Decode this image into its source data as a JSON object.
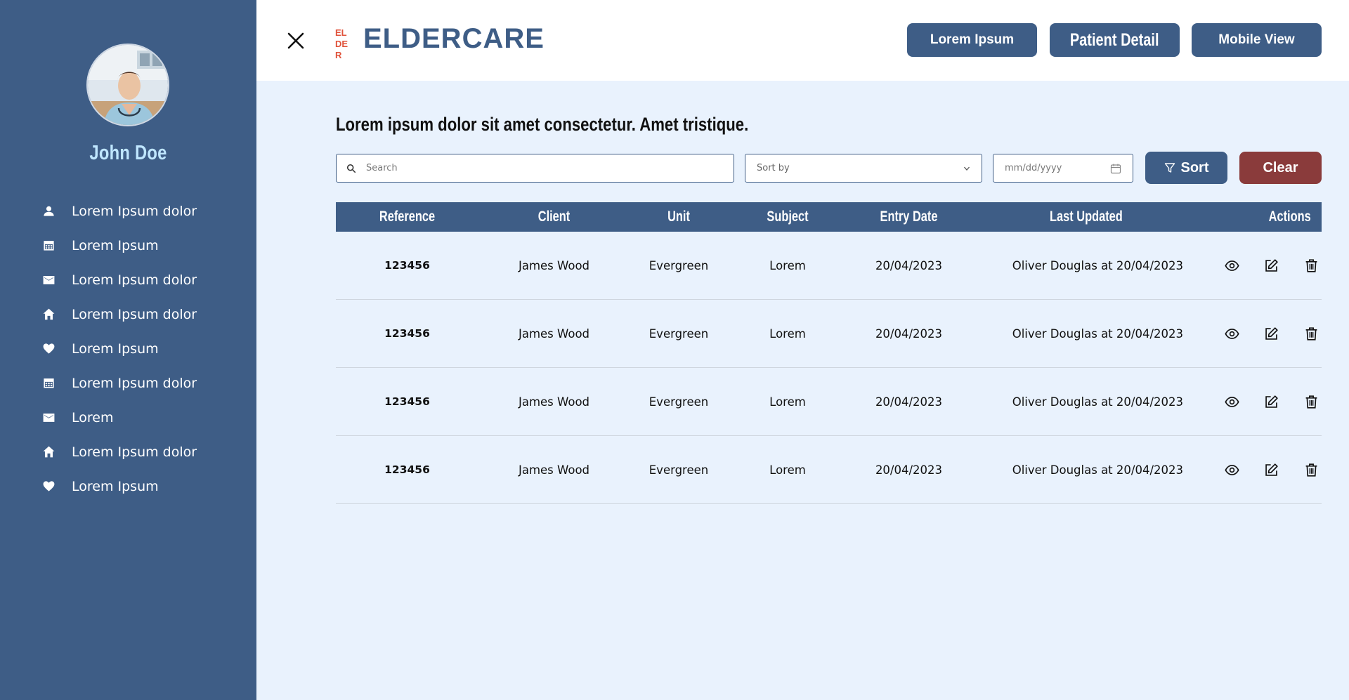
{
  "sidebar": {
    "user_name": "John Doe",
    "items": [
      {
        "label": "Lorem Ipsum dolor",
        "icon": "person-icon"
      },
      {
        "label": "Lorem Ipsum",
        "icon": "calendar-icon"
      },
      {
        "label": "Lorem Ipsum dolor",
        "icon": "mail-icon"
      },
      {
        "label": "Lorem Ipsum dolor",
        "icon": "home-icon"
      },
      {
        "label": "Lorem Ipsum",
        "icon": "heart-icon"
      },
      {
        "label": "Lorem Ipsum dolor",
        "icon": "calendar-icon"
      },
      {
        "label": "Lorem",
        "icon": "mail-icon"
      },
      {
        "label": "Lorem Ipsum dolor",
        "icon": "home-icon"
      },
      {
        "label": "Lorem Ipsum",
        "icon": "heart-icon"
      }
    ]
  },
  "header": {
    "logo_text": "ELDERCARE",
    "logo_mark": [
      "EL",
      "DE",
      "R"
    ],
    "buttons": [
      "Lorem Ipsum",
      "Patient Detail",
      "Mobile View"
    ]
  },
  "main": {
    "heading": "Lorem ipsum dolor sit amet consectetur. Amet tristique.",
    "search_placeholder": "Search",
    "sort_by_placeholder": "Sort by",
    "date_placeholder": "mm/dd/yyyy",
    "sort_label": "Sort",
    "clear_label": "Clear"
  },
  "table": {
    "columns": [
      "Reference",
      "Client",
      "Unit",
      "Subject",
      "Entry Date",
      "Last Updated",
      "Actions"
    ],
    "rows": [
      {
        "reference": "123456",
        "client": "James Wood",
        "unit": "Evergreen",
        "subject": "Lorem",
        "entry_date": "20/04/2023",
        "last_updated": "Oliver Douglas at 20/04/2023"
      },
      {
        "reference": "123456",
        "client": "James Wood",
        "unit": "Evergreen",
        "subject": "Lorem",
        "entry_date": "20/04/2023",
        "last_updated": "Oliver Douglas at 20/04/2023"
      },
      {
        "reference": "123456",
        "client": "James Wood",
        "unit": "Evergreen",
        "subject": "Lorem",
        "entry_date": "20/04/2023",
        "last_updated": "Oliver Douglas at 20/04/2023"
      },
      {
        "reference": "123456",
        "client": "James Wood",
        "unit": "Evergreen",
        "subject": "Lorem",
        "entry_date": "20/04/2023",
        "last_updated": "Oliver Douglas at 20/04/2023"
      }
    ],
    "row_actions": [
      "view-icon",
      "edit-icon",
      "delete-icon"
    ]
  },
  "colors": {
    "primary": "#3e5d86",
    "danger": "#8a3b3b",
    "background": "#e9f2fd",
    "name_accent": "#bfe6ff",
    "logo_accent": "#e0523a"
  }
}
